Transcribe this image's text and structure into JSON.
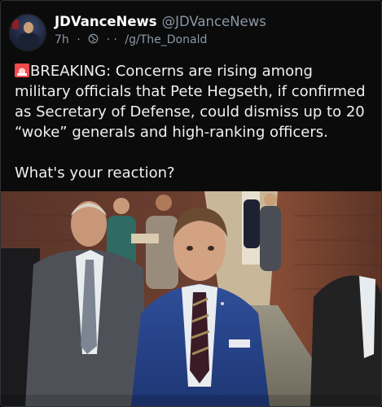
{
  "post": {
    "display_name": "JDVanceNews",
    "handle": "@JDVanceNews",
    "time": "7h",
    "dots": "· ·",
    "board": "/g/The_Donald",
    "text_main": "BREAKING: Concerns are rising among military officials that Pete Hegseth, if confirmed as Secretary of Defense, could dismiss up to 20 “woke” generals and high-ranking officers.",
    "text_question": "What's your reaction?"
  },
  "icons": {
    "avatar": "avatar-image",
    "globe": "globe-icon",
    "siren": "siren-emoji-icon"
  },
  "colors": {
    "background": "#0b0b0b",
    "text": "#eef0f2",
    "secondary": "#8b98a5",
    "siren_red": "#e53935"
  }
}
